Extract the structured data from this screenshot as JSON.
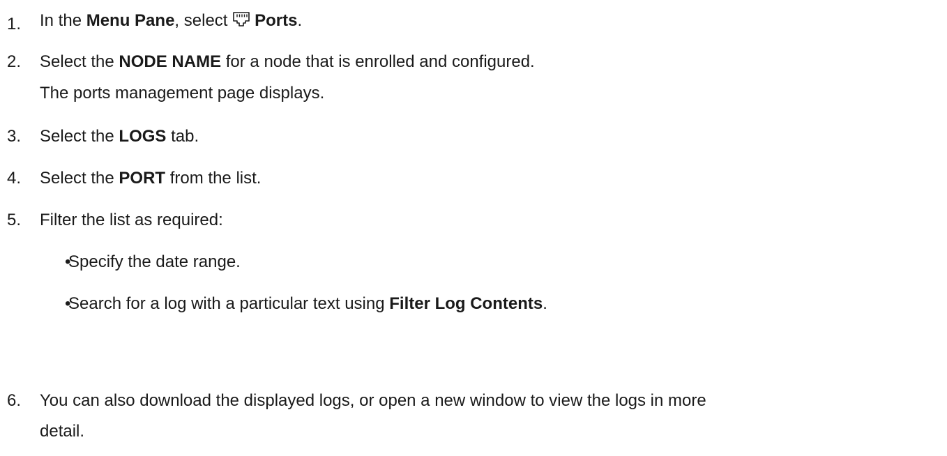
{
  "steps": [
    {
      "number": "1.",
      "parts": [
        "In the ",
        "Menu Pane",
        ", select ",
        "Ports",
        "."
      ],
      "icon": "ports-icon"
    },
    {
      "number": "2.",
      "parts": [
        "Select the ",
        "NODE NAME",
        " for a node that is enrolled and configured."
      ],
      "note": "The ports management page displays."
    },
    {
      "number": "3.",
      "parts": [
        "Select the ",
        "LOGS",
        " tab."
      ]
    },
    {
      "number": "4.",
      "parts": [
        "Select the ",
        "PORT",
        " from the list."
      ]
    },
    {
      "number": "5.",
      "text": "Filter the list as required:",
      "bullets": [
        {
          "parts": [
            "Specify the date range."
          ]
        },
        {
          "parts": [
            "Search for a log with a particular text using ",
            "Filter Log Contents",
            "."
          ]
        }
      ]
    },
    {
      "number": "6.",
      "line1": "You can also download the displayed logs, or open a new window to view the logs in more",
      "line2": "detail."
    }
  ],
  "bullet_glyph": "•"
}
